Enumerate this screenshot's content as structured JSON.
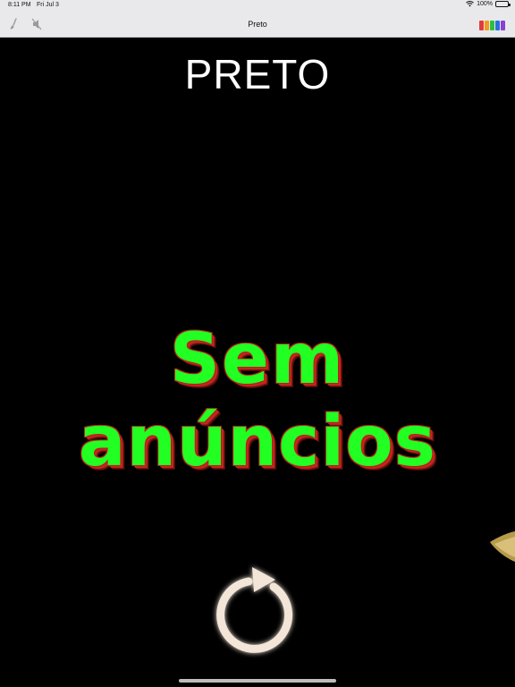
{
  "status_bar": {
    "time": "8:11 PM",
    "date": "Fri Jul 3",
    "battery": "100%"
  },
  "nav": {
    "title": "Preto",
    "left_icons": [
      "brush-icon",
      "mute-icon"
    ],
    "right_badge_colors": [
      "#e23b3b",
      "#f29b1d",
      "#2fbf3b",
      "#2a6fe0",
      "#8a3fd6"
    ]
  },
  "main": {
    "heading": "PRETO",
    "banner_line1": "Sem",
    "banner_line2": "anúncios",
    "banner_color": "#22ff22",
    "banner_outline_color": "#c4261d"
  },
  "controls": {
    "refresh_icon": "refresh-icon"
  }
}
